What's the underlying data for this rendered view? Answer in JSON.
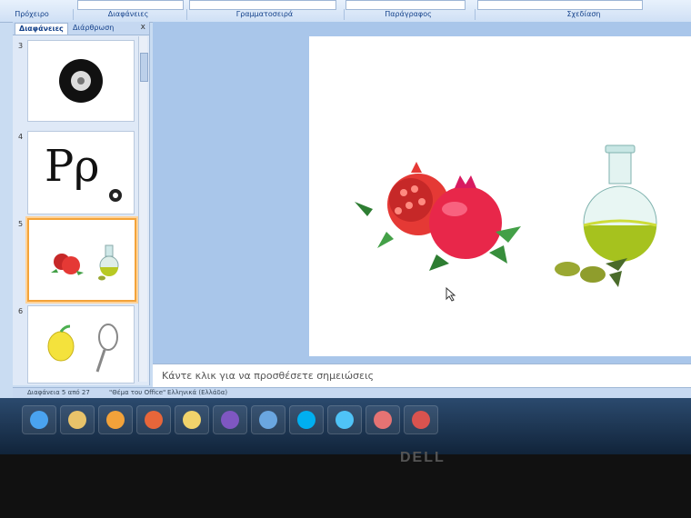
{
  "ribbon": {
    "groups": [
      "Πρόχειρο",
      "Διαφάνειες",
      "Γραμματοσειρά",
      "Παράγραφος",
      "Σχεδίαση"
    ],
    "top_text": "διαφάνειες"
  },
  "panel": {
    "tabs": [
      "Διαφάνειες",
      "Διάρθρωση"
    ],
    "close": "x",
    "slides": [
      {
        "num": "3",
        "kind": "tire"
      },
      {
        "num": "4",
        "kind": "letters",
        "text": "Ρρ"
      },
      {
        "num": "5",
        "kind": "pomegranate-oil",
        "selected": true
      },
      {
        "num": "6",
        "kind": "lemon-racket"
      }
    ]
  },
  "notes": {
    "placeholder": "Κάντε κλικ για να προσθέσετε σημειώσεις"
  },
  "status": {
    "slide_counter": "Διαφάνεια 5 από 27",
    "theme": "\"Θέμα του Office\"",
    "language": "Ελληνικά (Ελλάδα)"
  },
  "taskbar": {
    "apps": [
      {
        "name": "start",
        "color": "#4aa3f0"
      },
      {
        "name": "explorer",
        "color": "#e8c36a"
      },
      {
        "name": "media",
        "color": "#f2a23a"
      },
      {
        "name": "firefox",
        "color": "#e8663a"
      },
      {
        "name": "folder",
        "color": "#f1d36b"
      },
      {
        "name": "viber",
        "color": "#7e57c2"
      },
      {
        "name": "notepad",
        "color": "#6aa6e0"
      },
      {
        "name": "skype",
        "color": "#00aff0"
      },
      {
        "name": "chrome-like",
        "color": "#4fc3f7"
      },
      {
        "name": "unknown",
        "color": "#e57373"
      },
      {
        "name": "powerpoint",
        "color": "#d9534f"
      }
    ]
  },
  "brand": "DELL"
}
